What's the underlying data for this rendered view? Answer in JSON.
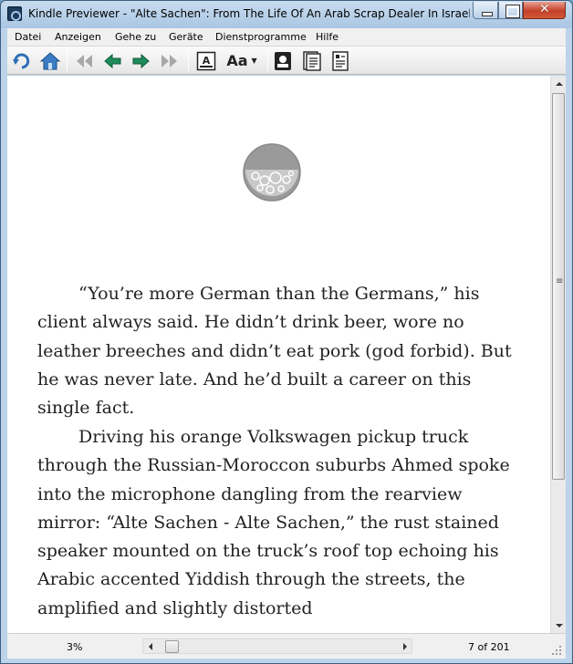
{
  "window": {
    "title": "Kindle  Previewer - \"Alte Sachen\": From The Life Of An Arab Scrap Dealer In Israel (a short"
  },
  "menu": {
    "items": [
      "Datei",
      "Anzeigen",
      "Gehe zu",
      "Geräte",
      "Dienstprogramme",
      "Hilfe"
    ]
  },
  "toolbar": {
    "font_size_label": "Aa",
    "icons": [
      "back-icon",
      "home-icon",
      "first-page-icon",
      "previous-page-icon",
      "next-page-icon",
      "last-page-icon",
      "text-view-icon",
      "font-size-icon",
      "kindle-device-icon",
      "page-view-icon",
      "book-details-icon"
    ]
  },
  "book": {
    "paragraphs": [
      "“You’re more German than the Germans,” his client always said. He didn’t drink beer, wore no leather breeches and didn’t eat pork (god forbid). But he was never late. And he’d built a career on this single fact.",
      "Driving his orange Volkswagen pickup truck through the Russian-Moroccon suburbs Ahmed spoke into the microphone dangling from the rearview mirror: “Alte Sachen - Alte Sachen,” the rust stained speaker mounted on the truck’s roof top echoing his Arabic accented Yiddish through the streets, the amplified and slightly distorted"
    ]
  },
  "status": {
    "progress_percent": "3%",
    "page_position": "7 of 201",
    "progress_fraction": 0.03
  },
  "colors": {
    "titlebar": "#a9c6e3",
    "close_button": "#c4412a",
    "ornament": "#9a9a9a",
    "body_text": "#222222"
  }
}
